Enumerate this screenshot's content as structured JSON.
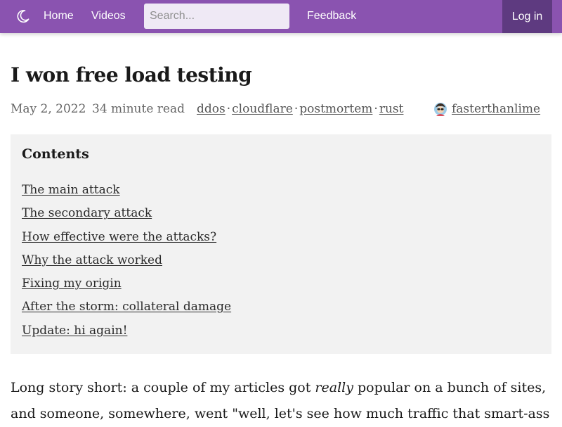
{
  "nav": {
    "icons": {
      "theme_toggle": "moon-icon"
    },
    "home_label": "Home",
    "videos_label": "Videos",
    "search_placeholder": "Search...",
    "search_value": "",
    "feedback_label": "Feedback",
    "login_label": "Log in"
  },
  "colors": {
    "navbar_bg": "#8a53b0",
    "login_bg": "#5e3a80",
    "search_bg": "#efe9f5",
    "toc_bg": "#f2f2f2",
    "meta_text": "#666666"
  },
  "article": {
    "title": "I won free load testing",
    "date": "May 2, 2022",
    "read_time": "34 minute read",
    "tags": [
      "ddos",
      "cloudflare",
      "postmortem",
      "rust"
    ],
    "tag_separator": "·",
    "author": "fasterthanlime",
    "author_avatar_icon": "avatar-icon"
  },
  "toc": {
    "heading": "Contents",
    "items": [
      "The main attack",
      "The secondary attack",
      "How effective were the attacks?",
      "Why the attack worked",
      "Fixing my origin",
      "After the storm: collateral damage",
      "Update: hi again!"
    ]
  },
  "body": {
    "line1_before": "Long story short: a couple of my articles got ",
    "line1_emphasis": "really",
    "line1_after": " popular on a bunch of sites,",
    "line2": "and someone, somewhere, went \"well, let's see how much traffic that smart-ass"
  }
}
